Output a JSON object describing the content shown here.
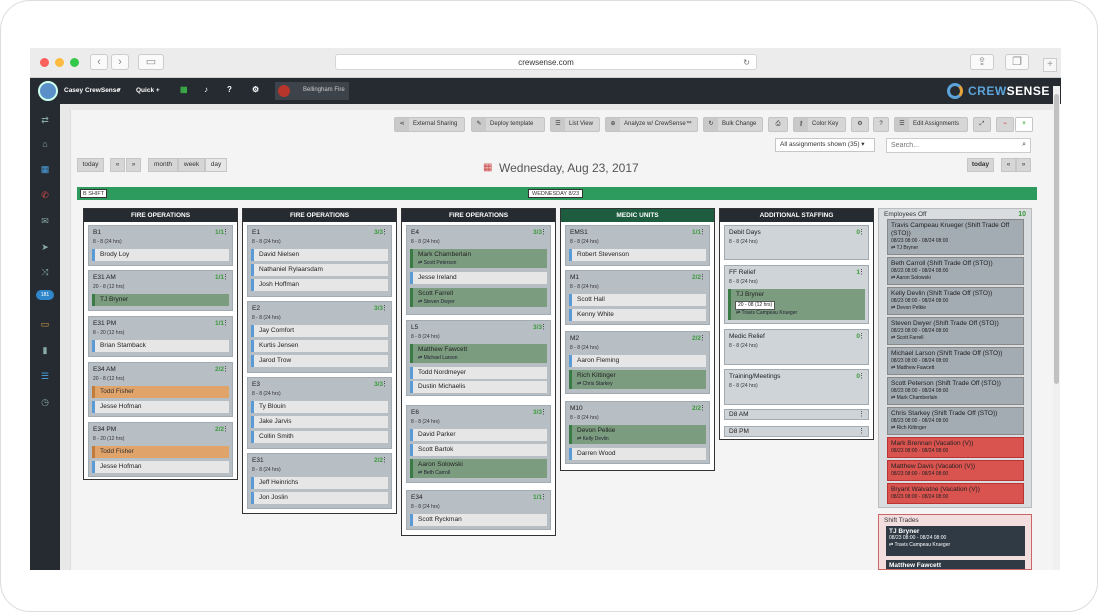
{
  "browser": {
    "url": "crewsense.com"
  },
  "nav": {
    "user": "Casey CrewSense",
    "quick": "Quick +",
    "org": "Bellingham Fire",
    "brand": "CREWSENSE",
    "brand_accent": "CREW",
    "brand_rest": "SENSE",
    "badge": "181"
  },
  "toolbar": [
    "External Sharing",
    "Deploy template",
    "List View",
    "Analyze w/ CrewSense™",
    "Bulk Change",
    "Color Key",
    "Edit Assignments"
  ],
  "nav2": {
    "today": "today",
    "prev": "«",
    "next": "»",
    "month": "month",
    "week": "week",
    "day": "day",
    "date": "Wednesday, Aug 23, 2017",
    "today_r": "today",
    "assign_filter": "All assignments shown (35)",
    "search_placeholder": "Search..."
  },
  "shift": {
    "label": "B SHIFT",
    "date": "WEDNESDAY 8/23"
  },
  "columns": {
    "c1": {
      "title": "FIRE OPERATIONS"
    },
    "c2": {
      "title": "FIRE OPERATIONS"
    },
    "c3": {
      "title": "FIRE OPERATIONS"
    },
    "c4": {
      "title": "MEDIC UNITS"
    },
    "c5": {
      "title": "ADDITIONAL STAFFING"
    }
  },
  "cards": {
    "b1": {
      "name": "B1",
      "count": "1/1",
      "sub": "8 - 8 (24 hrs)",
      "s1": "Brody Loy"
    },
    "e31am": {
      "name": "E31 AM",
      "count": "1/1",
      "sub": "20 - 8 (12 hrs)",
      "s1": "TJ Bryner"
    },
    "e31pm": {
      "name": "E31 PM",
      "count": "1/1",
      "sub": "8 - 20 (12 hrs)",
      "s1": "Brian Stamback"
    },
    "e34am": {
      "name": "E34 AM",
      "count": "2/2",
      "sub": "20 - 8 (12 hrs)",
      "s1": "Todd Fisher",
      "s2": "Jesse Hofman"
    },
    "e34pm": {
      "name": "E34 PM",
      "count": "2/2",
      "sub": "8 - 20 (12 hrs)",
      "s1": "Todd Fisher",
      "s2": "Jesse Hofman"
    },
    "e1": {
      "name": "E1",
      "count": "3/3",
      "sub": "8 - 8 (24 hrs)",
      "s1": "David Nielsen",
      "s2": "Nathaniel Rylaarsdam",
      "s3": "Josh Hoffman"
    },
    "e2": {
      "name": "E2",
      "count": "3/3",
      "sub": "8 - 8 (24 hrs)",
      "s1": "Jay Comfort",
      "s2": "Kurtis Jensen",
      "s3": "Jarod Trow"
    },
    "e3": {
      "name": "E3",
      "count": "3/3",
      "sub": "8 - 8 (24 hrs)",
      "s1": "Ty Blouin",
      "s2": "Jake Jarvis",
      "s3": "Collin Smith"
    },
    "e31": {
      "name": "E31",
      "count": "2/2",
      "sub": "8 - 8 (24 hrs)",
      "s1": "Jeff Heinrichs",
      "s2": "Jon Joslin"
    },
    "e4": {
      "name": "E4",
      "count": "3/3",
      "sub": "8 - 8 (24 hrs)",
      "s1": "Mark Chamberlain",
      "s1t": "⇄ Scott Peterson",
      "s2": "Jesse Ireland",
      "s3": "Scott Farrell",
      "s3t": "⇄ Steven Dwyer"
    },
    "l5": {
      "name": "L5",
      "count": "3/3",
      "sub": "8 - 8 (24 hrs)",
      "s1": "Matthew Fawcett",
      "s1t": "⇄ Michael Larson",
      "s2": "Todd Nordmeyer",
      "s3": "Dustin Michaelis"
    },
    "e6": {
      "name": "E6",
      "count": "3/3",
      "sub": "8 - 8 (24 hrs)",
      "s1": "David Parker",
      "s2": "Scott Bartok",
      "s3": "Aaron Solowski",
      "s3t": "⇄ Beth Carroll"
    },
    "e34": {
      "name": "E34",
      "count": "1/1",
      "sub": "8 - 8 (24 hrs)",
      "s1": "Scott Ryckman"
    },
    "ems1": {
      "name": "EMS1",
      "count": "1/1",
      "sub": "8 - 8 (24 hrs)",
      "s1": "Robert Stevenson"
    },
    "m1": {
      "name": "M1",
      "count": "2/2",
      "sub": "8 - 8 (24 hrs)",
      "s1": "Scott Hall",
      "s2": "Kenny White"
    },
    "m2": {
      "name": "M2",
      "count": "2/2",
      "sub": "8 - 8 (24 hrs)",
      "s1": "Aaron Fleming",
      "s2": "Rich Kittinger",
      "s2t": "⇄ Chris Starkey"
    },
    "m10": {
      "name": "M10",
      "count": "2/2",
      "sub": "8 - 8 (24 hrs)",
      "s1": "Devon Pelkie",
      "s1t": "⇄ Kelly Devlin",
      "s2": "Darren Wood"
    },
    "debit": {
      "name": "Debit Days",
      "count": "0",
      "sub": "8 - 8 (24 hrs)"
    },
    "ff": {
      "name": "FF Relief",
      "count": "1",
      "sub": "8 - 8 (24 hrs)",
      "s1": "TJ Bryner",
      "tip": "20 - 08 (12 hrs)",
      "s1t": "⇄ Travis Campeau Krueger"
    },
    "medic": {
      "name": "Medic Relief",
      "count": "0",
      "sub": "8 - 8 (24 hrs)"
    },
    "training": {
      "name": "Training/Meetings",
      "count": "0",
      "sub": "8 - 8 (24 hrs)"
    },
    "d8am": {
      "name": "D8 AM"
    },
    "d8pm": {
      "name": "D8 PM"
    }
  },
  "employees_off": {
    "title": "Employees Off",
    "count": "10"
  },
  "emp": [
    {
      "n": "Travis Campeau Krueger (Shift Trade Off (STO))",
      "d": "08/23 08:00 - 08/24 08:00",
      "t": "⇄ TJ Bryner"
    },
    {
      "n": "Beth Carroll (Shift Trade Off (STO))",
      "d": "08/23 08:00 - 08/24 08:00",
      "t": "⇄ Aaron Solowski"
    },
    {
      "n": "Kelly Devlin (Shift Trade Off (STO))",
      "d": "08/23 08:00 - 08/24 08:00",
      "t": "⇄ Devon Pelkie"
    },
    {
      "n": "Steven Dwyer (Shift Trade Off (STO))",
      "d": "08/23 08:00 - 08/24 08:00",
      "t": "⇄ Scott Farrell"
    },
    {
      "n": "Michael Larson (Shift Trade Off (STO))",
      "d": "08/23 08:00 - 08/24 08:00",
      "t": "⇄ Matthew Fawcett"
    },
    {
      "n": "Scott Peterson (Shift Trade Off (STO))",
      "d": "08/23 08:00 - 08/24 08:00",
      "t": "⇄ Mark Chamberlain"
    },
    {
      "n": "Chris Starkey (Shift Trade Off (STO))",
      "d": "08/23 08:00 - 08/24 08:00",
      "t": "⇄ Rich Kittinger"
    },
    {
      "n": "Mark Brennan (Vacation (V))",
      "d": "08/23 08:00 - 08/24 08:00"
    },
    {
      "n": "Matthew Davis (Vacation (V))",
      "d": "08/23 08:00 - 08/24 08:00"
    },
    {
      "n": "Bryant Walvatne (Vacation (V))",
      "d": "08/23 08:00 - 08/24 08:00"
    }
  ],
  "shift_trades": {
    "title": "Shift Trades",
    "t1": {
      "n": "TJ Bryner",
      "d": "08/23 08:00 - 08/24 08:00",
      "t": "⇄ Travis Campeau Krueger"
    },
    "t2": {
      "n": "Matthew Fawcett"
    }
  }
}
